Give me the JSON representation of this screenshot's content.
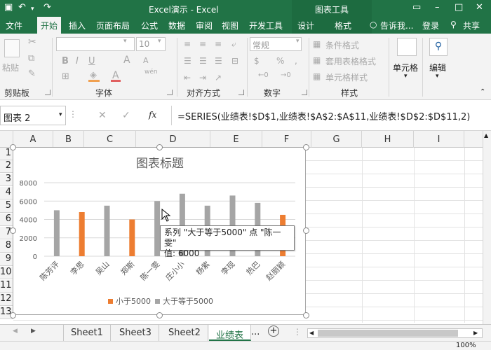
{
  "window": {
    "title": "Excel演示 - Excel",
    "context_tab_title": "图表工具"
  },
  "ribbon_tabs": [
    "文件",
    "开始",
    "插入",
    "页面布局",
    "公式",
    "数据",
    "审阅",
    "视图",
    "开发工具",
    "设计",
    "格式"
  ],
  "ribbon_right": {
    "tell_me": "告诉我...",
    "login": "登录",
    "share": "共享"
  },
  "ribbon": {
    "clipboard": {
      "paste": "粘贴",
      "label": "剪贴板"
    },
    "font": {
      "size": "10",
      "wen": "wén",
      "label": "字体"
    },
    "alignment": {
      "label": "对齐方式"
    },
    "number": {
      "format": "常规",
      "label": "数字"
    },
    "styles": {
      "conditional_format": "条件格式",
      "table_format": "套用表格格式",
      "cell_styles": "单元格样式",
      "label": "样式"
    },
    "cells": {
      "label": "单元格"
    },
    "editing": {
      "label": "编辑"
    }
  },
  "formula_bar": {
    "name_box": "图表 2",
    "formula": "=SERIES(业绩表!$D$1,业绩表!$A$2:$A$11,业绩表!$D$2:$D$11,2)"
  },
  "columns": [
    "A",
    "B",
    "C",
    "D",
    "E",
    "F",
    "G",
    "H",
    "I"
  ],
  "rows": [
    "1",
    "2",
    "3",
    "4",
    "5",
    "6",
    "7",
    "8",
    "9",
    "10",
    "11",
    "12",
    "13"
  ],
  "chart_data": {
    "type": "bar",
    "title": "图表标题",
    "categories": [
      "陈芳评",
      "李思",
      "吴山",
      "郑斯",
      "陈一雯",
      "庄小小",
      "杨紫",
      "李现",
      "热巴",
      "赵丽颖"
    ],
    "series": [
      {
        "name": "小于5000",
        "color": "#ED7D31",
        "values": [
          null,
          4800,
          null,
          4000,
          null,
          null,
          null,
          null,
          null,
          4500
        ]
      },
      {
        "name": "大于等于5000",
        "color": "#A5A5A5",
        "values": [
          5000,
          null,
          5500,
          null,
          6000,
          6800,
          5500,
          6600,
          5800,
          null
        ]
      }
    ],
    "ylim": [
      0,
      8000
    ],
    "yticks": [
      0,
      2000,
      4000,
      6000,
      8000
    ],
    "legend_position": "bottom",
    "grid": true
  },
  "tooltip": {
    "line1": "系列 \"大于等于5000\" 点 \"陈一雯\"",
    "line2": "值: 6000"
  },
  "sheets": [
    "Sheet1",
    "Sheet3",
    "Sheet2",
    "业绩表"
  ],
  "active_sheet": "业绩表",
  "sheet_more": "...",
  "status": {
    "zoom": "100%"
  }
}
